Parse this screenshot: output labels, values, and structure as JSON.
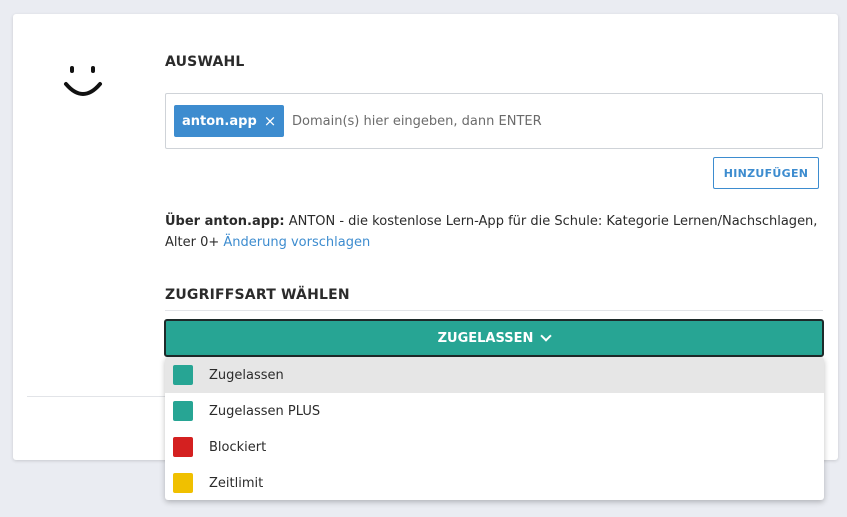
{
  "card": {
    "smiley_icon": "smiley-face-icon"
  },
  "auswahl": {
    "title": "AUSWAHL",
    "tag_label": "anton.app",
    "tag_remove_glyph": "×",
    "input_placeholder": "Domain(s) hier eingeben, dann ENTER",
    "input_value": "",
    "add_button": "HINZUFÜGEN"
  },
  "info": {
    "prefix": "Über anton.app:",
    "text": " ANTON - die kostenlose Lern-App für die Schule: Kategorie Lernen/Nachschlagen, Alter 0+ ",
    "link": "Änderung vorschlagen"
  },
  "zugriff": {
    "title": "ZUGRIFFSART WÄHLEN",
    "selected": "ZUGELASSEN",
    "options": [
      {
        "label": "Zugelassen",
        "color": "#27a594",
        "active": true
      },
      {
        "label": "Zugelassen PLUS",
        "color": "#27a594",
        "active": false
      },
      {
        "label": "Blockiert",
        "color": "#d42020",
        "active": false
      },
      {
        "label": "Zeitlimit",
        "color": "#f0c000",
        "active": false
      }
    ]
  },
  "colors": {
    "accent": "#3d8ccf",
    "teal": "#27a594",
    "background": "#eaecf2"
  }
}
